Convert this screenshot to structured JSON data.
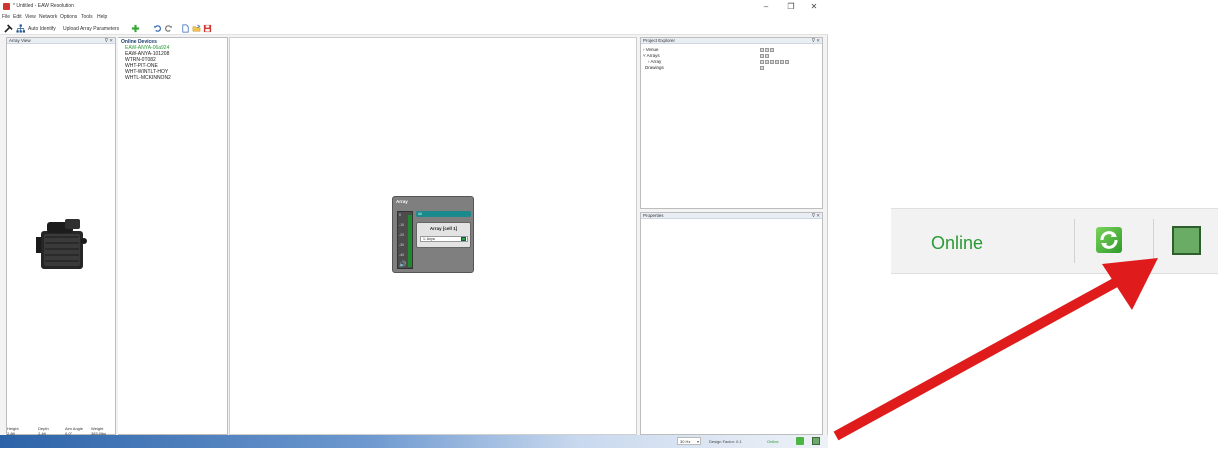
{
  "window": {
    "title": "* Untitled - EAW Resolution",
    "controls": {
      "minimize": "–",
      "maximize": "❐",
      "close": "✕"
    }
  },
  "menu": [
    "File",
    "Edit",
    "View",
    "Network",
    "Options",
    "Tools",
    "Help"
  ],
  "toolbar": {
    "auto_identify": "Auto Identify",
    "upload": "Upload Array Parameters"
  },
  "array_view": {
    "title": "Array View",
    "controls": "ᐁ ✕",
    "specs": [
      {
        "label": "Height",
        "value": "2.8ft"
      },
      {
        "label": "Depth",
        "value": "2.4ft"
      },
      {
        "label": "Aim Angle",
        "value": "0.0°"
      },
      {
        "label": "Weight",
        "value": "383.0lbs"
      }
    ]
  },
  "online_devices": {
    "header": "Online Devices",
    "items": [
      "EAW-ANYA-06a924",
      "EAW-ANYA-101208",
      "WTRN-0T082",
      "WHT-PIT-ONE",
      "WHT-WINTLT-HOY",
      "WHTL-MCKINNON2"
    ],
    "first_item_color": "#2a9a36"
  },
  "array_node": {
    "title": "Array",
    "bar_label": "All",
    "inner_title": "Array [cell 1]",
    "row_label": "1: Anya",
    "ticks": [
      "0",
      "-10",
      "-20",
      "-30",
      "-40"
    ]
  },
  "project_explorer": {
    "title": "Project Explorer",
    "controls": "ᐁ ✕",
    "items": [
      "Venue",
      "Arrays",
      "Array",
      "Drawings"
    ]
  },
  "properties": {
    "title": "Properties",
    "controls": "ᐁ ✕"
  },
  "status": {
    "frequency": "30 Hz",
    "design_factor": "Design Factor: 0.1",
    "online": "Online"
  },
  "zoom": {
    "online": "Online"
  },
  "colors": {
    "accent_green": "#2a9a36",
    "arrow": "#e01b1b",
    "status_blue": "#2c63a8"
  }
}
